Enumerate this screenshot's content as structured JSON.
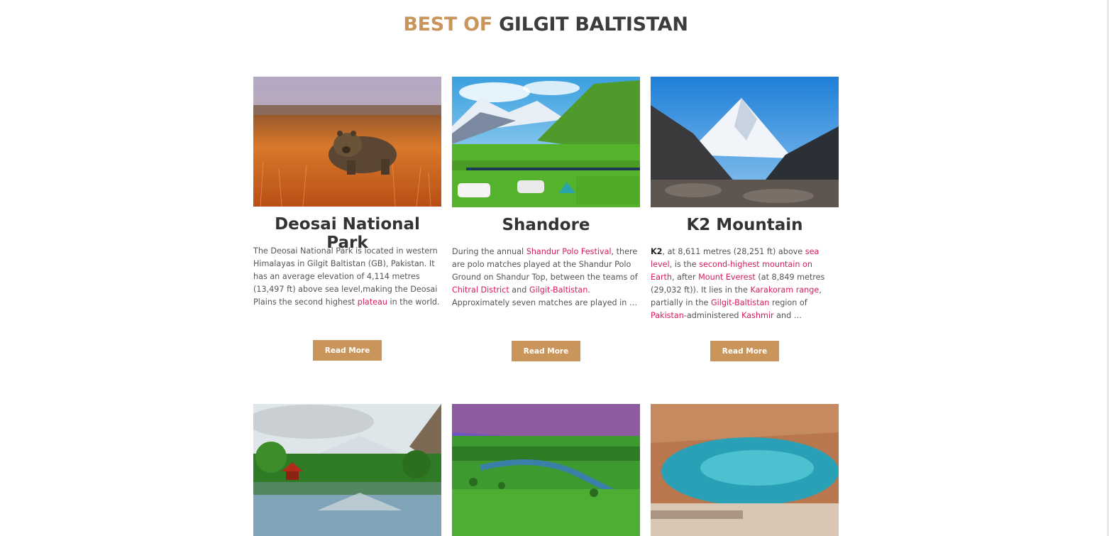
{
  "section_title": {
    "accent": "BEST OF",
    "main": "GILGIT BALTISTAN"
  },
  "accent_color": "#c9955a",
  "link_color": "#d81b60",
  "cards": [
    {
      "image": "deosai-bear-photo",
      "title": "Deosai National Park",
      "description": [
        {
          "t": "The Deosai National Park is located in western Himalayas in Gilgit Baltistan (GB), Pakistan. It has an average elevation of 4,114 metres (13,497 ft) above sea level,making the Deosai Plains the second highest "
        },
        {
          "t": "plateau",
          "link": true
        },
        {
          "t": " in the world."
        }
      ],
      "button": "Read More"
    },
    {
      "image": "shandur-polo-ground-photo",
      "title": "Shandore",
      "description": [
        {
          "t": "During the annual "
        },
        {
          "t": "Shandur Polo Festival",
          "link": true
        },
        {
          "t": ", there are polo matches played at the Shandur Polo Ground on Shandur Top, between the teams of "
        },
        {
          "t": "Chitral District",
          "link": true
        },
        {
          "t": " and "
        },
        {
          "t": "Gilgit-Baltistan",
          "link": true
        },
        {
          "t": ". Approximately seven matches are played in …"
        }
      ],
      "button": "Read More"
    },
    {
      "image": "k2-peak-photo",
      "title": "K2 Mountain",
      "description": [
        {
          "t": "K2",
          "bold": true
        },
        {
          "t": ", at 8,611 metres (28,251 ft) above "
        },
        {
          "t": "sea level",
          "link": true
        },
        {
          "t": ", is the "
        },
        {
          "t": "second-highest mountain on Earth",
          "link": true
        },
        {
          "t": ", after "
        },
        {
          "t": "Mount Everest",
          "link": true
        },
        {
          "t": " (at 8,849 metres (29,032 ft)). It lies in the "
        },
        {
          "t": "Karakoram range",
          "link": true
        },
        {
          "t": ", partially in the "
        },
        {
          "t": "Gilgit-Baltistan",
          "link": true
        },
        {
          "t": " region of "
        },
        {
          "t": "Pakistan",
          "link": true
        },
        {
          "t": "-administered "
        },
        {
          "t": "Kashmir",
          "link": true
        },
        {
          "t": " and …"
        }
      ],
      "button": "Read More"
    },
    {
      "image": "shangrila-lake-pagoda-photo"
    },
    {
      "image": "phander-valley-photo"
    },
    {
      "image": "attabad-lake-photo"
    }
  ]
}
